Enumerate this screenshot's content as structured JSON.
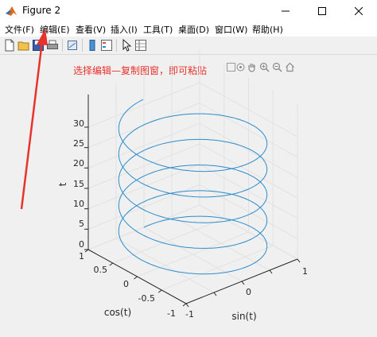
{
  "window": {
    "title": "Figure 2"
  },
  "menu": [
    "文件(F)",
    "编辑(E)",
    "查看(V)",
    "插入(I)",
    "工具(T)",
    "桌面(D)",
    "窗口(W)",
    "帮助(H)"
  ],
  "annotation": {
    "text": "选择编辑—复制图窗，即可粘贴",
    "color": "#e8322b"
  },
  "plot": {
    "xlabel": "sin(t)",
    "ylabel": "cos(t)",
    "zlabel": "t",
    "z_ticks": [
      "0",
      "5",
      "10",
      "15",
      "20",
      "25",
      "30"
    ],
    "y_ticks": [
      "1",
      "0.5",
      "0",
      "-0.5",
      "-1"
    ],
    "x_ticks": [
      "-1",
      "0",
      "1"
    ],
    "line_color": "#2b8ccc"
  },
  "chart_data": {
    "type": "line",
    "plot_kind": "3D helix",
    "x_label": "sin(t)",
    "y_label": "cos(t)",
    "z_label": "t",
    "x_range": [
      -1,
      1
    ],
    "y_range": [
      -1,
      1
    ],
    "z_range": [
      0,
      30
    ],
    "t_range": [
      0,
      31.4
    ],
    "grid": true,
    "series": [
      {
        "x": "sin(t)",
        "y": "cos(t)",
        "z": "t"
      }
    ]
  }
}
